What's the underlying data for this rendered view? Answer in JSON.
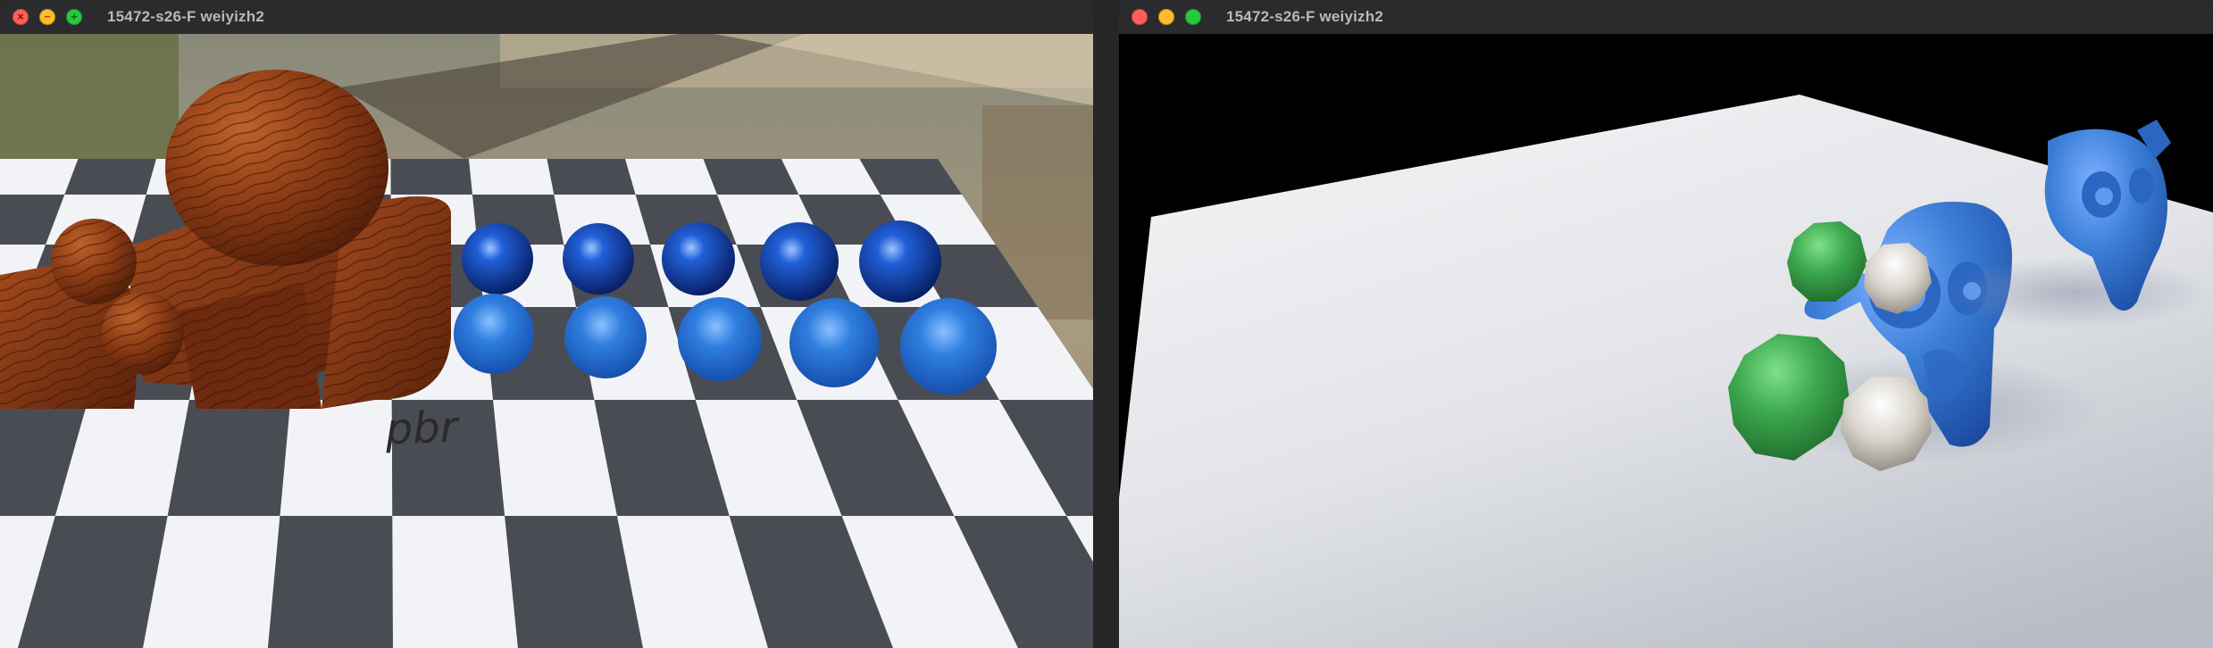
{
  "windows": [
    {
      "title": "15472-s26-F weiyizh2",
      "scene": {
        "label": "pbr",
        "material": "wood",
        "sphere_colors": [
          "#1a5fd0",
          "#2f7fe0"
        ]
      }
    },
    {
      "title": "15472-s26-F weiyizh2",
      "scene": {
        "monkey_color": "#3c7fd8",
        "sphere_green": "#3ca84e",
        "sphere_white": "#d8d4cc",
        "floor_color": "#e2e4e8"
      }
    }
  ],
  "controls": {
    "close_glyph": "×",
    "minimize_glyph": "−",
    "zoom_glyph": "+"
  },
  "colors": {
    "close": "#fe5f57",
    "minimize": "#febc2e",
    "zoom": "#28c840",
    "titlebar": "#2b2b2d"
  }
}
